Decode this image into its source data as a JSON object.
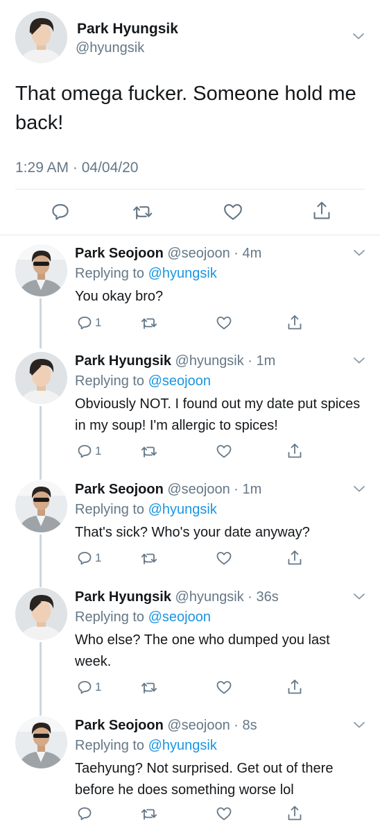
{
  "main_tweet": {
    "name": "Park Hyungsik",
    "handle": "@hyungsik",
    "text": "That omega fucker. Someone hold me back!",
    "timestamp": "1:29 AM · 04/04/20",
    "icons": [
      "reply-icon",
      "retweet-icon",
      "like-icon",
      "share-icon"
    ]
  },
  "replies": [
    {
      "name": "Park Seojoon",
      "handle_time": "@seojoon · 4m",
      "replying_prefix": "Replying to",
      "replying_to": "@hyungsik",
      "text": "You okay bro?",
      "reply_count": "1"
    },
    {
      "name": "Park Hyungsik",
      "handle_time": "@hyungsik · 1m",
      "replying_prefix": "Replying to",
      "replying_to": "@seojoon",
      "text": "Obviously NOT. I found out my date put spices in my soup! I'm allergic to spices!",
      "reply_count": "1"
    },
    {
      "name": "Park Seojoon",
      "handle_time": "@seojoon · 1m",
      "replying_prefix": "Replying to",
      "replying_to": "@hyungsik",
      "text": "That's sick? Who's your date anyway?",
      "reply_count": "1"
    },
    {
      "name": "Park Hyungsik",
      "handle_time": "@hyungsik · 36s",
      "replying_prefix": "Replying to",
      "replying_to": "@seojoon",
      "text": "Who else? The one who dumped you last week.",
      "reply_count": "1"
    },
    {
      "name": "Park Seojoon",
      "handle_time": "@seojoon · 8s",
      "replying_prefix": "Replying to",
      "replying_to": "@hyungsik",
      "text": "Taehyung? Not surprised. Get out of there before he does something worse lol",
      "reply_count": ""
    }
  ],
  "colors": {
    "text": "#14171a",
    "secondary": "#657786",
    "link": "#1b95e0",
    "divider": "#e1e8ed",
    "thread_line": "#ccd6dd"
  }
}
